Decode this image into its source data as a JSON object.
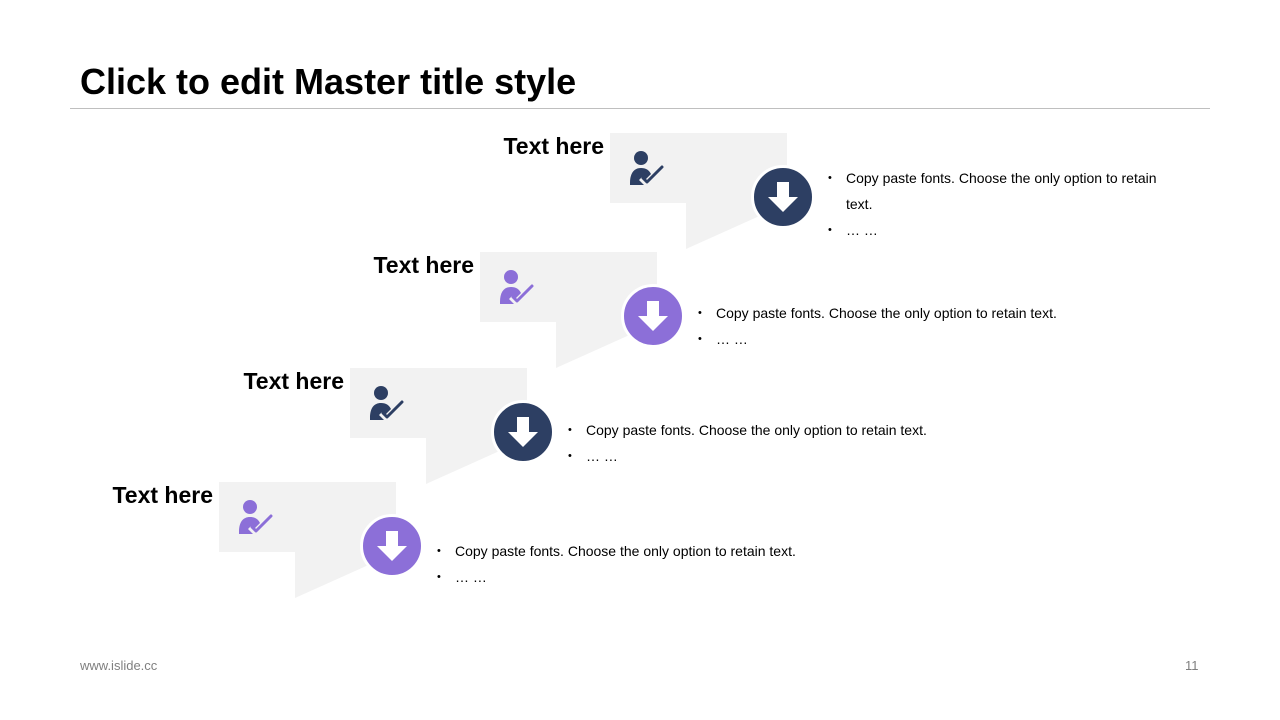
{
  "slide": {
    "title": "Click to edit Master title style",
    "footer_url": "www.islide.cc",
    "page_number": "11"
  },
  "colors": {
    "navy": "#2d3f63",
    "purple": "#8c6fd8",
    "shape_fill": "#f2f2f2"
  },
  "steps": [
    {
      "heading": "Text here",
      "icon": "person-check-icon",
      "arrow_icon": "arrow-down-icon",
      "accent": "navy",
      "bullets": [
        "Copy paste fonts. Choose the only option to retain text.",
        "… …"
      ]
    },
    {
      "heading": "Text here",
      "icon": "person-check-icon",
      "arrow_icon": "arrow-down-icon",
      "accent": "purple",
      "bullets": [
        "Copy paste fonts. Choose the only option to retain text.",
        "… …"
      ]
    },
    {
      "heading": "Text here",
      "icon": "person-check-icon",
      "arrow_icon": "arrow-down-icon",
      "accent": "navy",
      "bullets": [
        "Copy paste fonts. Choose the only option to retain text.",
        "… …"
      ]
    },
    {
      "heading": "Text here",
      "icon": "person-check-icon",
      "arrow_icon": "arrow-down-icon",
      "accent": "purple",
      "bullets": [
        "Copy paste fonts. Choose the only option to retain text.",
        "… …"
      ]
    }
  ]
}
